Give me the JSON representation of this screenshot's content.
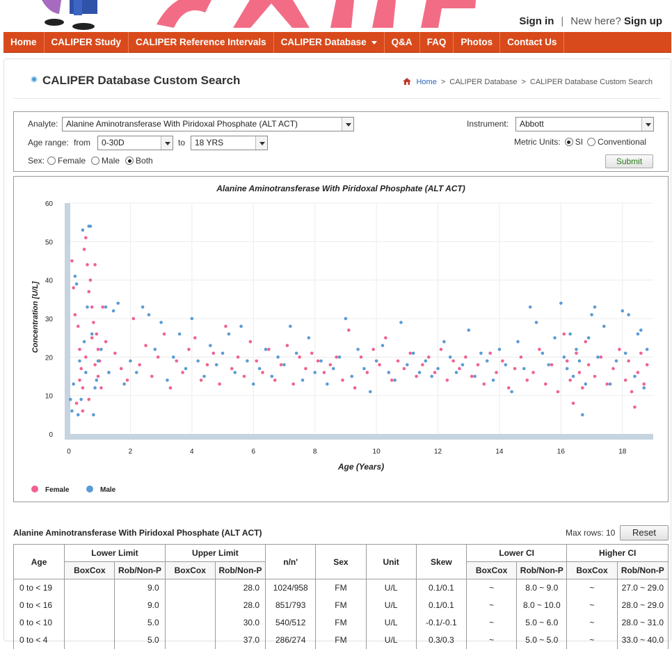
{
  "header": {
    "sign_in": "Sign in",
    "separator": "|",
    "new_here": "New here?",
    "sign_up": "Sign up"
  },
  "nav": [
    {
      "label": "Home"
    },
    {
      "label": "CALIPER Study"
    },
    {
      "label": "CALIPER Reference Intervals"
    },
    {
      "label": "CALIPER Database",
      "dropdown": true
    },
    {
      "label": "Q&A"
    },
    {
      "label": "FAQ"
    },
    {
      "label": "Photos"
    },
    {
      "label": "Contact Us"
    }
  ],
  "page": {
    "title": "CALIPER Database Custom Search",
    "breadcrumb": [
      "Home",
      "CALIPER Database",
      "CALIPER Database Custom Search"
    ]
  },
  "form": {
    "analyte_label": "Analyte:",
    "analyte_value": "Alanine Aminotransferase With Piridoxal Phosphate (ALT ACT)",
    "age_range_label": "Age range:",
    "from_label": "from",
    "from_value": "0-30D",
    "to_label": "to",
    "to_value": "18 YRS",
    "sex_label": "Sex:",
    "sex_options": [
      "Female",
      "Male",
      "Both"
    ],
    "sex_selected": "Both",
    "instrument_label": "Instrument:",
    "instrument_value": "Abbott",
    "metric_label": "Metric Units:",
    "metric_options": [
      "SI",
      "Conventional"
    ],
    "metric_selected": "SI",
    "submit_label": "Submit"
  },
  "chart_data": {
    "type": "scatter",
    "title": "Alanine Aminotransferase With Piridoxal Phosphate (ALT ACT)",
    "xlabel": "Age (Years)",
    "ylabel": "Concentration [U/L]",
    "xlim": [
      0,
      19
    ],
    "ylim": [
      0,
      60
    ],
    "xticks": [
      0,
      2,
      4,
      6,
      8,
      10,
      12,
      14,
      16,
      18
    ],
    "yticks": [
      0,
      10,
      20,
      30,
      40,
      50,
      60
    ],
    "grid": true,
    "legend_position": "bottom-left",
    "series": [
      {
        "name": "Female",
        "color": "#f06292",
        "points": [
          [
            0.1,
            45
          ],
          [
            0.15,
            38
          ],
          [
            0.2,
            31
          ],
          [
            0.3,
            28
          ],
          [
            0.35,
            22
          ],
          [
            0.4,
            17
          ],
          [
            0.45,
            12
          ],
          [
            0.5,
            48
          ],
          [
            0.55,
            51
          ],
          [
            0.6,
            44
          ],
          [
            0.65,
            37
          ],
          [
            0.7,
            40
          ],
          [
            0.75,
            33
          ],
          [
            0.8,
            29
          ],
          [
            0.85,
            44
          ],
          [
            0.9,
            26
          ],
          [
            0.95,
            22
          ],
          [
            1.0,
            19
          ],
          [
            1.1,
            33
          ],
          [
            1.2,
            24
          ],
          [
            1.3,
            16
          ],
          [
            0.25,
            8
          ],
          [
            0.35,
            14
          ],
          [
            0.45,
            6
          ],
          [
            0.55,
            20
          ],
          [
            0.65,
            9
          ],
          [
            0.75,
            25
          ],
          [
            0.85,
            18
          ],
          [
            0.95,
            15
          ],
          [
            1.05,
            12
          ],
          [
            1.5,
            21
          ],
          [
            1.7,
            17
          ],
          [
            1.9,
            14
          ],
          [
            2.1,
            30
          ],
          [
            2.3,
            18
          ],
          [
            2.5,
            23
          ],
          [
            2.7,
            15
          ],
          [
            2.9,
            20
          ],
          [
            3.1,
            26
          ],
          [
            3.3,
            12
          ],
          [
            3.5,
            19
          ],
          [
            3.7,
            16
          ],
          [
            3.9,
            22
          ],
          [
            4.1,
            25
          ],
          [
            4.3,
            14
          ],
          [
            4.5,
            18
          ],
          [
            4.7,
            21
          ],
          [
            4.9,
            13
          ],
          [
            5.1,
            28
          ],
          [
            5.3,
            17
          ],
          [
            5.5,
            20
          ],
          [
            5.7,
            15
          ],
          [
            5.9,
            24
          ],
          [
            6.1,
            19
          ],
          [
            6.3,
            16
          ],
          [
            6.5,
            22
          ],
          [
            6.7,
            14
          ],
          [
            6.9,
            18
          ],
          [
            7.1,
            23
          ],
          [
            7.3,
            13
          ],
          [
            7.5,
            20
          ],
          [
            7.7,
            17
          ],
          [
            7.9,
            21
          ],
          [
            8.1,
            19
          ],
          [
            8.3,
            16
          ],
          [
            8.5,
            18
          ],
          [
            8.7,
            20
          ],
          [
            8.9,
            14
          ],
          [
            9.1,
            27
          ],
          [
            9.3,
            12
          ],
          [
            9.5,
            20
          ],
          [
            9.7,
            16
          ],
          [
            9.9,
            22
          ],
          [
            10.1,
            18
          ],
          [
            10.3,
            25
          ],
          [
            10.5,
            14
          ],
          [
            10.7,
            19
          ],
          [
            10.9,
            17
          ],
          [
            11.1,
            21
          ],
          [
            11.3,
            15
          ],
          [
            11.5,
            18
          ],
          [
            11.7,
            20
          ],
          [
            11.9,
            16
          ],
          [
            12.1,
            22
          ],
          [
            12.3,
            14
          ],
          [
            12.5,
            19
          ],
          [
            12.7,
            17
          ],
          [
            12.9,
            20
          ],
          [
            13.1,
            15
          ],
          [
            13.3,
            18
          ],
          [
            13.5,
            13
          ],
          [
            13.7,
            21
          ],
          [
            13.9,
            16
          ],
          [
            14.1,
            19
          ],
          [
            14.3,
            12
          ],
          [
            14.5,
            17
          ],
          [
            14.7,
            20
          ],
          [
            14.9,
            14
          ],
          [
            15.1,
            16
          ],
          [
            15.3,
            22
          ],
          [
            15.5,
            13
          ],
          [
            15.7,
            18
          ],
          [
            15.9,
            11
          ],
          [
            16.1,
            26
          ],
          [
            16.2,
            19
          ],
          [
            16.3,
            14
          ],
          [
            16.4,
            8
          ],
          [
            16.5,
            21
          ],
          [
            16.6,
            16
          ],
          [
            16.7,
            12
          ],
          [
            16.8,
            24
          ],
          [
            16.9,
            18
          ],
          [
            17.1,
            15
          ],
          [
            17.3,
            20
          ],
          [
            17.5,
            13
          ],
          [
            17.7,
            17
          ],
          [
            17.9,
            22
          ],
          [
            18.1,
            14
          ],
          [
            18.2,
            19
          ],
          [
            18.3,
            11
          ],
          [
            18.4,
            7
          ],
          [
            18.5,
            16
          ],
          [
            18.6,
            21
          ],
          [
            18.7,
            13
          ],
          [
            18.8,
            18
          ]
        ]
      },
      {
        "name": "Male",
        "color": "#5b9bd5",
        "points": [
          [
            0.05,
            9
          ],
          [
            0.1,
            6
          ],
          [
            0.15,
            13
          ],
          [
            0.2,
            41
          ],
          [
            0.25,
            39
          ],
          [
            0.3,
            5
          ],
          [
            0.35,
            19
          ],
          [
            0.4,
            9
          ],
          [
            0.45,
            53
          ],
          [
            0.5,
            24
          ],
          [
            0.55,
            16
          ],
          [
            0.6,
            33
          ],
          [
            0.65,
            54
          ],
          [
            0.7,
            54
          ],
          [
            0.75,
            26
          ],
          [
            0.8,
            5
          ],
          [
            0.85,
            12
          ],
          [
            0.9,
            14
          ],
          [
            0.95,
            19
          ],
          [
            1.05,
            22
          ],
          [
            1.2,
            33
          ],
          [
            1.3,
            16
          ],
          [
            1.45,
            32
          ],
          [
            1.6,
            34
          ],
          [
            1.8,
            13
          ],
          [
            2.0,
            19
          ],
          [
            2.2,
            16
          ],
          [
            2.4,
            33
          ],
          [
            2.6,
            31
          ],
          [
            2.8,
            22
          ],
          [
            3.0,
            29
          ],
          [
            3.2,
            14
          ],
          [
            3.4,
            20
          ],
          [
            3.6,
            26
          ],
          [
            3.8,
            17
          ],
          [
            4.0,
            30
          ],
          [
            4.2,
            19
          ],
          [
            4.4,
            15
          ],
          [
            4.6,
            23
          ],
          [
            4.8,
            18
          ],
          [
            5.0,
            21
          ],
          [
            5.2,
            26
          ],
          [
            5.4,
            16
          ],
          [
            5.6,
            28
          ],
          [
            5.8,
            19
          ],
          [
            6.0,
            13
          ],
          [
            6.2,
            17
          ],
          [
            6.4,
            22
          ],
          [
            6.6,
            15
          ],
          [
            6.8,
            20
          ],
          [
            7.0,
            18
          ],
          [
            7.2,
            28
          ],
          [
            7.4,
            21
          ],
          [
            7.6,
            14
          ],
          [
            7.8,
            25
          ],
          [
            8.0,
            16
          ],
          [
            8.2,
            19
          ],
          [
            8.4,
            13
          ],
          [
            8.6,
            17
          ],
          [
            8.8,
            20
          ],
          [
            9.0,
            30
          ],
          [
            9.2,
            15
          ],
          [
            9.4,
            22
          ],
          [
            9.6,
            17
          ],
          [
            9.8,
            11
          ],
          [
            10.0,
            19
          ],
          [
            10.2,
            23
          ],
          [
            10.4,
            16
          ],
          [
            10.6,
            14
          ],
          [
            10.8,
            29
          ],
          [
            11.0,
            18
          ],
          [
            11.2,
            21
          ],
          [
            11.4,
            16
          ],
          [
            11.6,
            19
          ],
          [
            11.8,
            15
          ],
          [
            12.0,
            17
          ],
          [
            12.2,
            24
          ],
          [
            12.4,
            20
          ],
          [
            12.6,
            16
          ],
          [
            12.8,
            18
          ],
          [
            13.0,
            27
          ],
          [
            13.2,
            15
          ],
          [
            13.4,
            21
          ],
          [
            13.6,
            19
          ],
          [
            13.8,
            14
          ],
          [
            14.0,
            22
          ],
          [
            14.2,
            18
          ],
          [
            14.4,
            11
          ],
          [
            14.6,
            24
          ],
          [
            14.8,
            17
          ],
          [
            15.0,
            33
          ],
          [
            15.2,
            29
          ],
          [
            15.4,
            21
          ],
          [
            15.6,
            18
          ],
          [
            15.8,
            25
          ],
          [
            16.0,
            34
          ],
          [
            16.1,
            20
          ],
          [
            16.2,
            17
          ],
          [
            16.3,
            26
          ],
          [
            16.4,
            15
          ],
          [
            16.5,
            22
          ],
          [
            16.6,
            19
          ],
          [
            16.7,
            5
          ],
          [
            16.8,
            13
          ],
          [
            16.9,
            25
          ],
          [
            17.0,
            31
          ],
          [
            17.1,
            33
          ],
          [
            17.2,
            20
          ],
          [
            17.4,
            28
          ],
          [
            17.6,
            13
          ],
          [
            17.8,
            19
          ],
          [
            18.0,
            32
          ],
          [
            18.1,
            21
          ],
          [
            18.2,
            31
          ],
          [
            18.4,
            15
          ],
          [
            18.5,
            26
          ],
          [
            18.6,
            27
          ],
          [
            18.7,
            12
          ],
          [
            18.8,
            22
          ]
        ]
      }
    ]
  },
  "table": {
    "title": "Alanine Aminotransferase With Piridoxal Phosphate (ALT ACT)",
    "max_rows_label": "Max rows: 10",
    "reset_label": "Reset",
    "headers": {
      "age": "Age",
      "lower_limit": "Lower Limit",
      "upper_limit": "Upper Limit",
      "n": "n/n'",
      "sex": "Sex",
      "unit": "Unit",
      "skew": "Skew",
      "lower_ci": "Lower CI",
      "higher_ci": "Higher CI",
      "boxcox": "BoxCox",
      "robnonp": "Rob/Non-P"
    },
    "rows": [
      {
        "age": "0 to < 19",
        "ll_bc": "",
        "ll_rob": "9.0",
        "ul_bc": "",
        "ul_rob": "28.0",
        "n": "1024/958",
        "sex": "FM",
        "unit": "U/L",
        "skew": "0.1/0.1",
        "lci_bc": "~",
        "lci_rob": "8.0 ~ 9.0",
        "hci_bc": "~",
        "hci_rob": "27.0 ~ 29.0"
      },
      {
        "age": "0 to < 16",
        "ll_bc": "",
        "ll_rob": "9.0",
        "ul_bc": "",
        "ul_rob": "28.0",
        "n": "851/793",
        "sex": "FM",
        "unit": "U/L",
        "skew": "0.1/0.1",
        "lci_bc": "~",
        "lci_rob": "8.0 ~ 10.0",
        "hci_bc": "~",
        "hci_rob": "28.0 ~ 29.0"
      },
      {
        "age": "0 to < 10",
        "ll_bc": "",
        "ll_rob": "5.0",
        "ul_bc": "",
        "ul_rob": "30.0",
        "n": "540/512",
        "sex": "FM",
        "unit": "U/L",
        "skew": "-0.1/-0.1",
        "lci_bc": "~",
        "lci_rob": "5.0 ~ 6.0",
        "hci_bc": "~",
        "hci_rob": "28.0 ~ 31.0"
      },
      {
        "age": "0 to < 4",
        "ll_bc": "",
        "ll_rob": "5.0",
        "ul_bc": "",
        "ul_rob": "37.0",
        "n": "286/274",
        "sex": "FM",
        "unit": "U/L",
        "skew": "0.3/0.3",
        "lci_bc": "~",
        "lci_rob": "5.0 ~ 5.0",
        "hci_bc": "~",
        "hci_rob": "33.0 ~ 40.0"
      }
    ]
  }
}
